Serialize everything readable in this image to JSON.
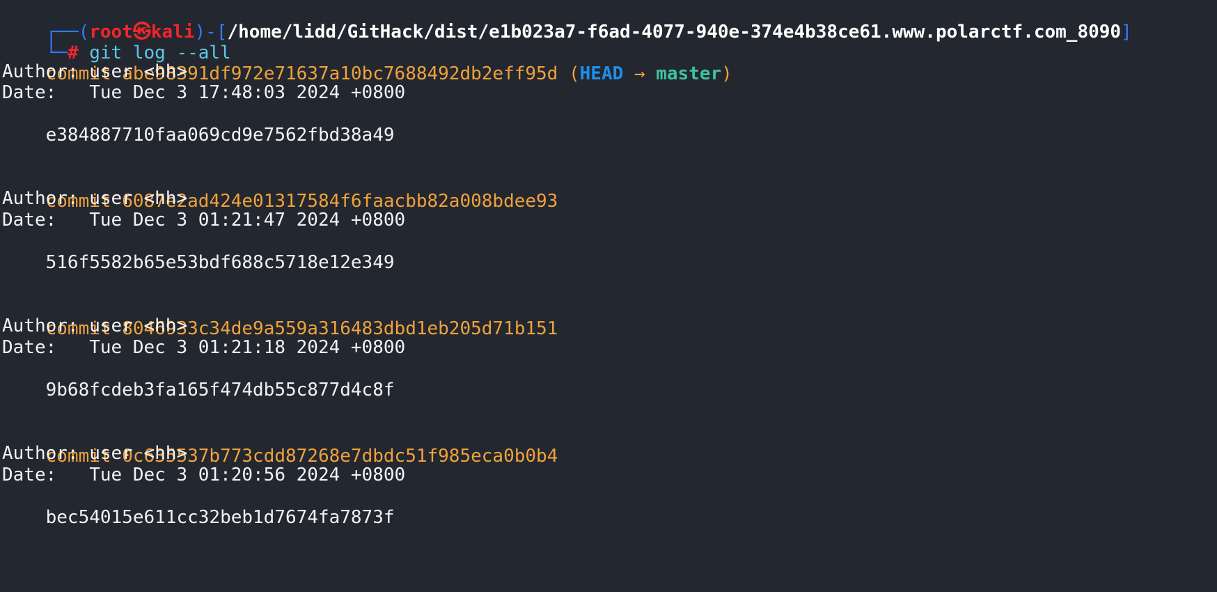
{
  "prompt": {
    "corner_top": "┌──(",
    "user": "root",
    "skull": "㉿",
    "host": "kali",
    "mid": ")-[",
    "path": "/home/lidd/GitHack/dist/e1b023a7-f6ad-4077-940e-374e4b38ce61.www.polarctf.com_8090",
    "close": "]",
    "corner_bottom": "└─",
    "hash": "#",
    "command": "git log --all"
  },
  "commits": [
    {
      "prefix": "commit ",
      "hash": "abe98391df972e71637a10bc7688492db2eff95d",
      "refs_open": " (",
      "head": "HEAD",
      "arrow": " → ",
      "branch": "master",
      "refs_close": ")",
      "author": "Author: user <hh>",
      "date": "Date:   Tue Dec 3 17:48:03 2024 +0800",
      "message": "    e384887710faa069cd9e7562fbd38a49"
    },
    {
      "prefix": "commit ",
      "hash": "6087e2ad424e01317584f6faacbb82a008bdee93",
      "author": "Author: user <hh>",
      "date": "Date:   Tue Dec 3 01:21:47 2024 +0800",
      "message": "    516f5582b65e53bdf688c5718e12e349"
    },
    {
      "prefix": "commit ",
      "hash": "8046933c34de9a559a316483dbd1eb205d71b151",
      "author": "Author: user <hh>",
      "date": "Date:   Tue Dec 3 01:21:18 2024 +0800",
      "message": "    9b68fcdeb3fa165f474db55c877d4c8f"
    },
    {
      "prefix": "commit ",
      "hash": "0c635537b773cdd87268e7dbdc51f985eca0b0b4",
      "author": "Author: user <hh>",
      "date": "Date:   Tue Dec 3 01:20:56 2024 +0800",
      "message": "    bec54015e611cc32beb1d7674fa7873f"
    }
  ],
  "colors": {
    "background": "#232730",
    "prompt_bracket": "#2f7cff",
    "user_host": "#f0262b",
    "command": "#5fc6e7",
    "commit_hash": "#f0a23a",
    "head_ref": "#1e8fe8",
    "branch_ref": "#3dc2a3"
  }
}
